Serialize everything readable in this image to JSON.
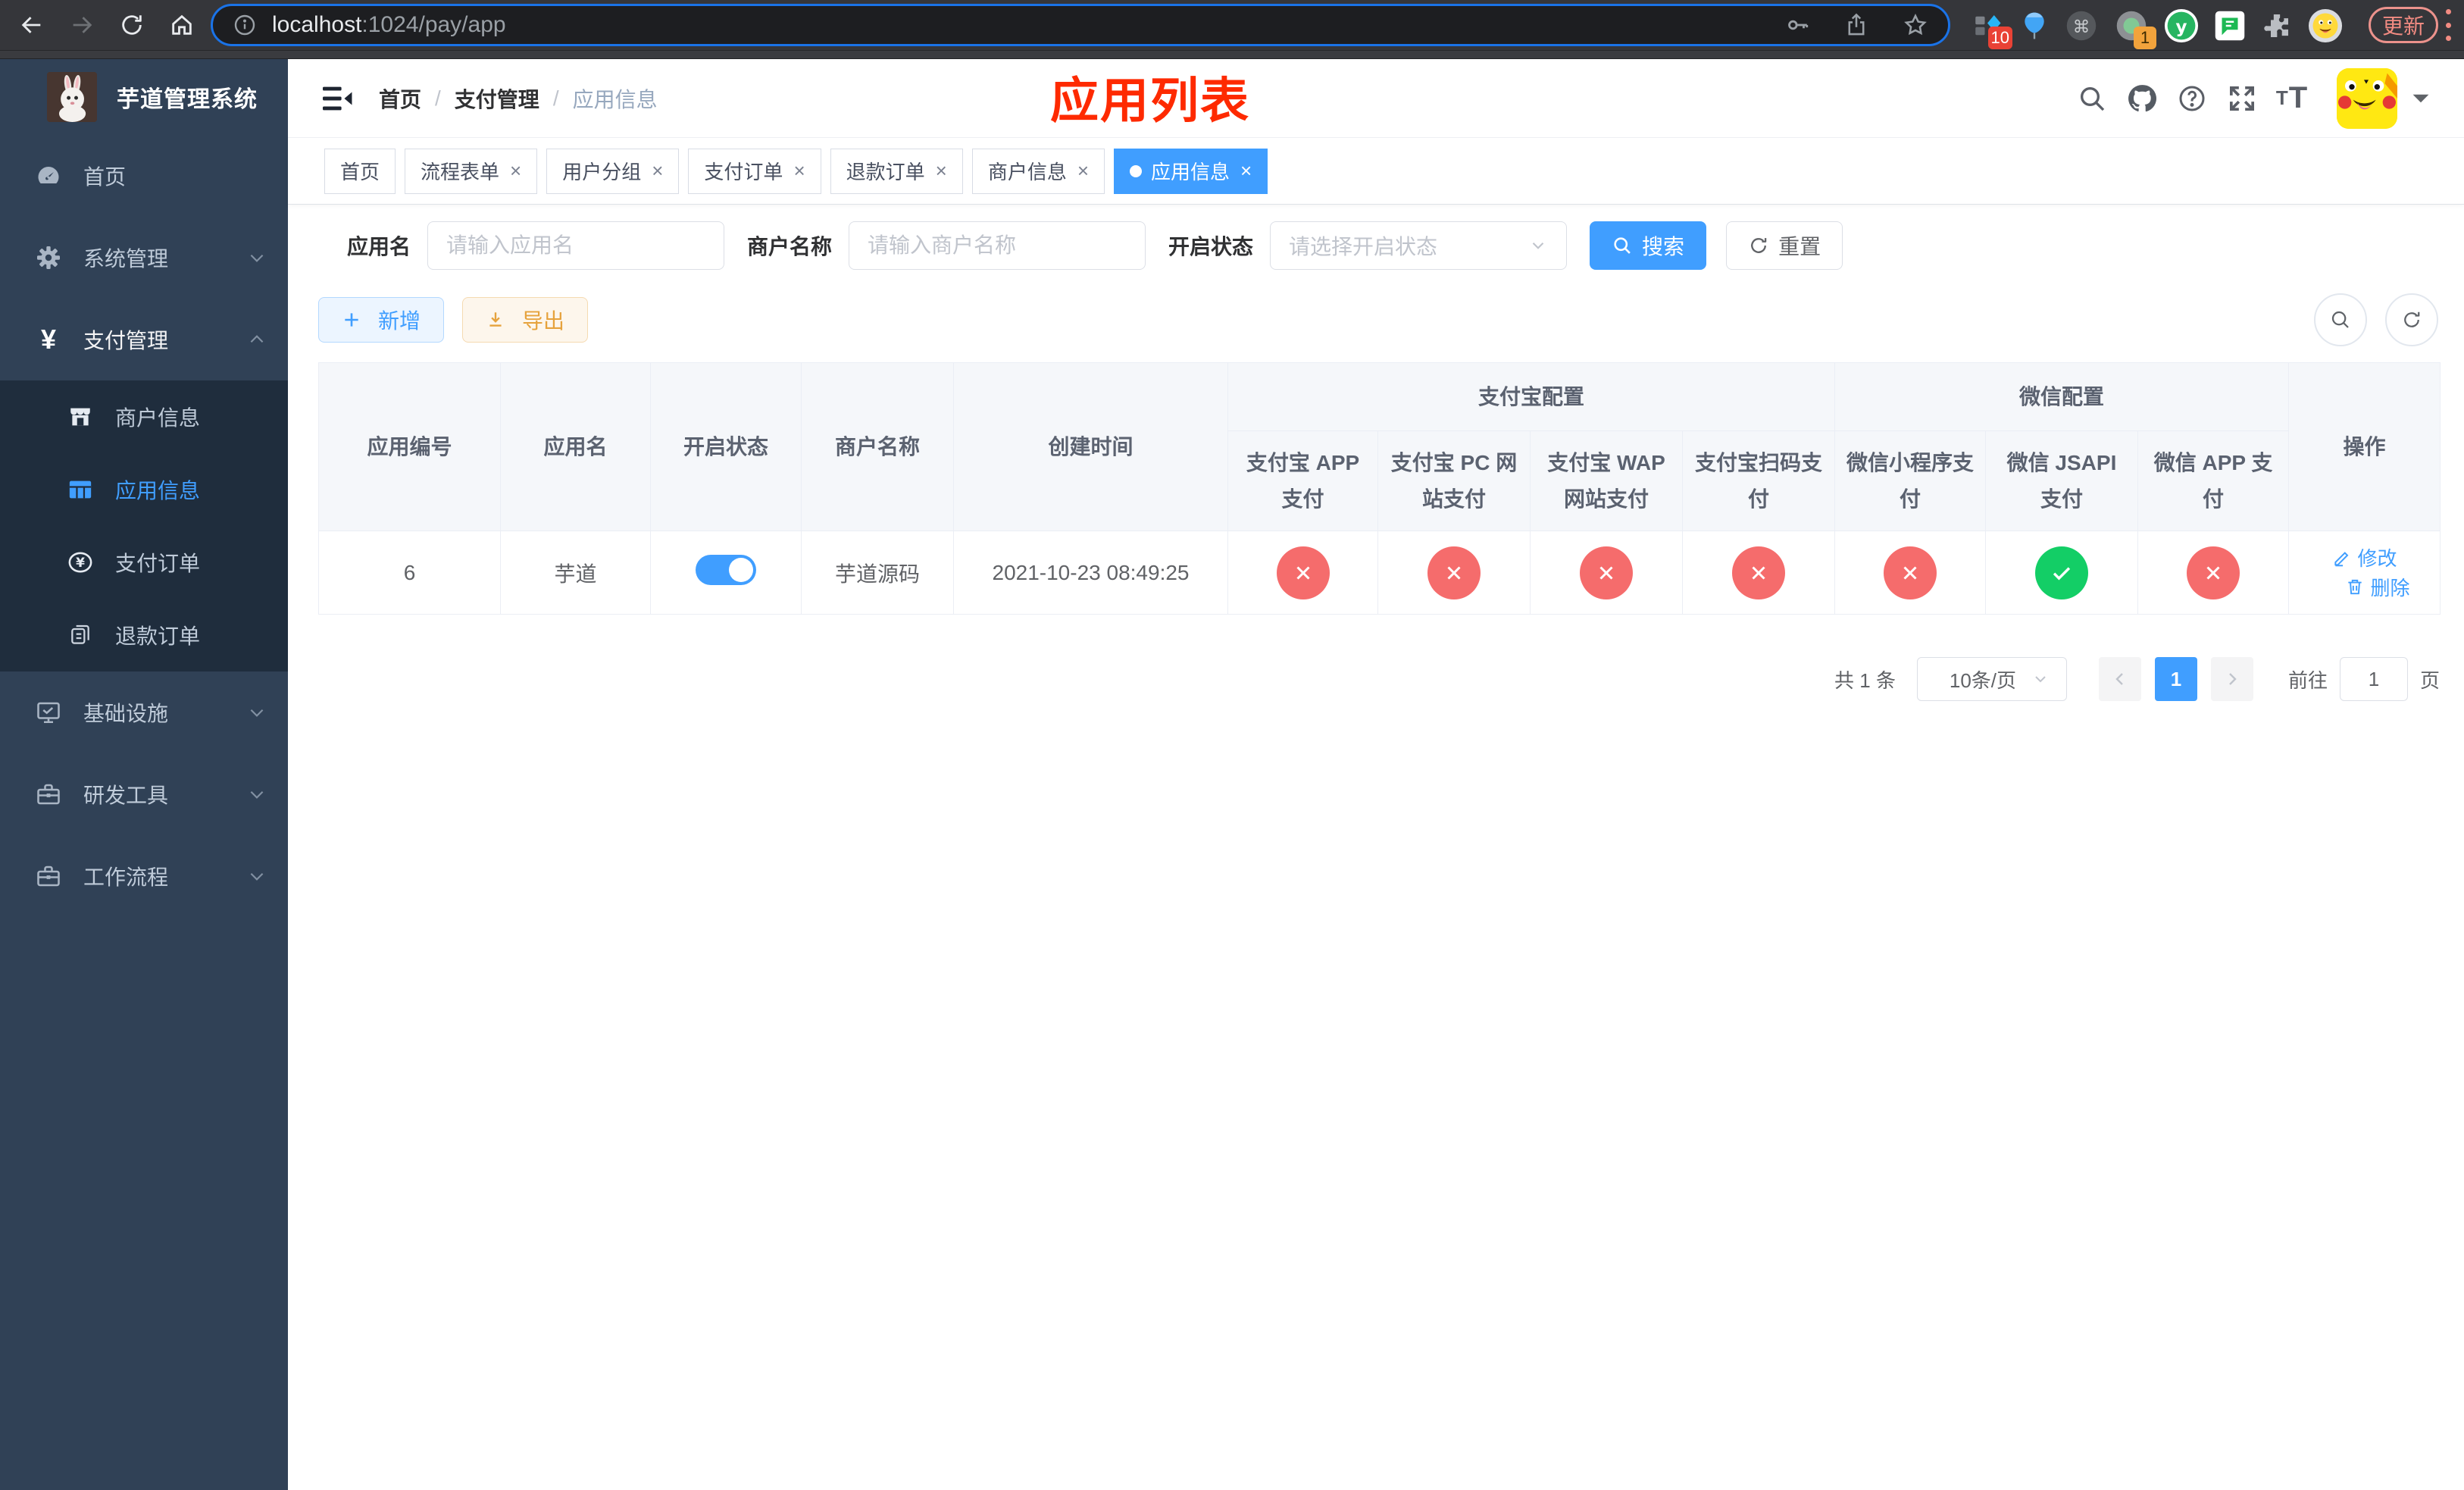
{
  "browser": {
    "url": {
      "host": "localhost",
      "rest": ":1024/pay/app"
    },
    "update_label": "更新",
    "ext_badge_pinia": "10",
    "ext_badge_recorder": "1"
  },
  "annotation": {
    "text": "应用列表",
    "color": "#fe2a00"
  },
  "sidebar": {
    "title": "芋道管理系统",
    "menu": {
      "home": "首页",
      "system": "系统管理",
      "pay": "支付管理",
      "infra": "基础设施",
      "devtool": "研发工具",
      "workflow": "工作流程"
    },
    "submenu": {
      "merchant": "商户信息",
      "app": "应用信息",
      "order": "支付订单",
      "refund": "退款订单"
    }
  },
  "breadcrumb": {
    "0": "首页",
    "1": "支付管理",
    "2": "应用信息"
  },
  "tabs": [
    {
      "label": "首页"
    },
    {
      "label": "流程表单",
      "close": "×"
    },
    {
      "label": "用户分组",
      "close": "×"
    },
    {
      "label": "支付订单",
      "close": "×"
    },
    {
      "label": "退款订单",
      "close": "×"
    },
    {
      "label": "商户信息",
      "close": "×"
    },
    {
      "label": "应用信息",
      "close": "×"
    }
  ],
  "filters": {
    "app_name_label": "应用名",
    "app_name_placeholder": "请输入应用名",
    "merchant_label": "商户名称",
    "merchant_placeholder": "请输入商户名称",
    "status_label": "开启状态",
    "status_placeholder": "请选择开启状态",
    "search_button": "搜索",
    "reset_button": "重置"
  },
  "toolbar": {
    "add_button": "新增",
    "export_button": "导出"
  },
  "table": {
    "headers": {
      "app_id": "应用编号",
      "app_name": "应用名",
      "status": "开启状态",
      "merchant_name": "商户名称",
      "create_time": "创建时间",
      "alipay_group": "支付宝配置",
      "wechat_group": "微信配置",
      "alipay_app": "支付宝 APP 支付",
      "alipay_pc": "支付宝 PC 网站支付",
      "alipay_wap": "支付宝 WAP 网站支付",
      "alipay_qr": "支付宝扫码支付",
      "wechat_lite": "微信小程序支付",
      "wechat_jsapi": "微信 JSAPI 支付",
      "wechat_app": "微信 APP 支付",
      "actions": "操作"
    },
    "rows": [
      {
        "app_id": "6",
        "app_name": "芋道",
        "status_enabled": true,
        "merchant_name": "芋道源码",
        "create_time": "2021-10-23 08:49:25",
        "channels": {
          "alipay_app": false,
          "alipay_pc": false,
          "alipay_wap": false,
          "alipay_qr": false,
          "wechat_lite": false,
          "wechat_jsapi": true,
          "wechat_app": false
        },
        "edit_label": "修改",
        "delete_label": "删除"
      }
    ]
  },
  "pagination": {
    "total_text": "共 1 条",
    "page_size": "10条/页",
    "current_page": "1",
    "goto_label": "前往",
    "goto_value": "1",
    "goto_unit": "页"
  },
  "colors": {
    "primary": "#409eff",
    "success": "#13ce66",
    "danger": "#f56c6c",
    "warning": "#e6a23c",
    "sidebar_bg": "#304156",
    "submenu_bg": "#1f2d3d"
  }
}
